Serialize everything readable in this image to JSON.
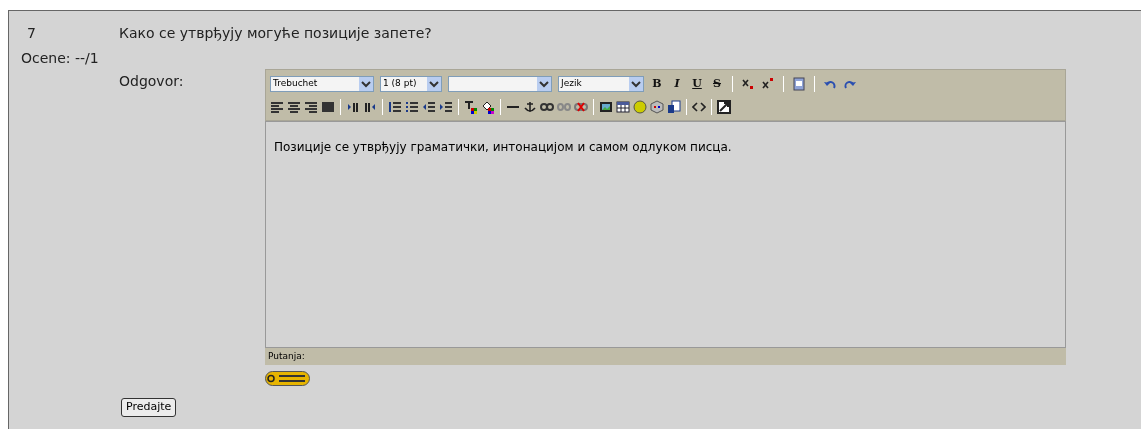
{
  "question": {
    "number": "7",
    "text": "Како се утврђују могуће позиције запете?",
    "grade": "Ocene: --/1"
  },
  "answer": {
    "label": "Odgovor:",
    "selects": [
      {
        "kind": "dropdown",
        "value": "Trebuchet"
      },
      {
        "kind": "dropdown",
        "value": "1 (8 pt)"
      },
      {
        "kind": "dropdown"
      },
      {
        "kind": "dropdown",
        "value": "Jezik"
      }
    ],
    "format_buttons": [
      {
        "label": "B",
        "kind": "bold"
      },
      {
        "label": "I",
        "kind": "italic"
      },
      {
        "label": "U",
        "kind": "underline"
      },
      {
        "label": "S",
        "kind": "strike"
      }
    ],
    "content": "Позиције се утврђују граматички, интонацијом и самом одлуком писца.",
    "path_label": "Putanja:"
  },
  "submit": "Predajte"
}
